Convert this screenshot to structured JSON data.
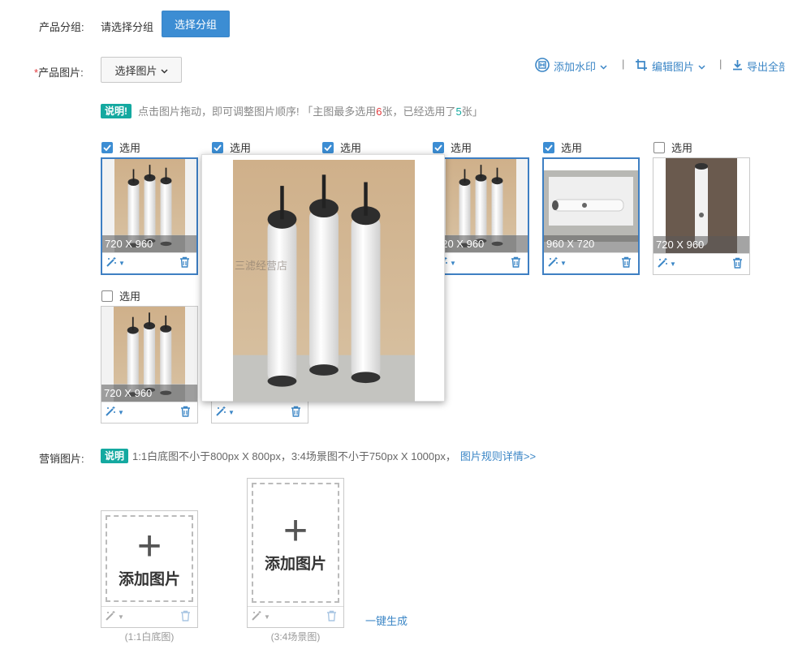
{
  "group": {
    "label": "产品分组:",
    "placeholder": "请选择分组",
    "button": "选择分组"
  },
  "images": {
    "label": "产品图片:",
    "required_mark": "*",
    "select_button": "选择图片",
    "toolbar": {
      "watermark": "添加水印",
      "edit": "编辑图片",
      "export": "导出全部"
    },
    "notice": {
      "tag": "说明!",
      "text_before": "点击图片拖动，即可调整图片顺序!  「主图最多选用",
      "max": "6",
      "text_mid": "张，已经选用了",
      "used": "5",
      "text_after": "张」"
    },
    "checkbox_label": "选用",
    "items": [
      {
        "checked": true,
        "dims": "720 X 960",
        "selected": true
      },
      {
        "checked": true,
        "dims": "",
        "selected": true
      },
      {
        "checked": true,
        "dims": "",
        "selected": true
      },
      {
        "checked": true,
        "dims": "720 X 960",
        "selected": true
      },
      {
        "checked": true,
        "dims": "960 X 720",
        "selected": true
      },
      {
        "checked": false,
        "dims": "720 X 960",
        "selected": false
      },
      {
        "checked": false,
        "dims": "720 X 960",
        "selected": false
      }
    ],
    "preview_watermark": "三滤经营店"
  },
  "marketing": {
    "label": "营销图片:",
    "tag": "说明",
    "text": "1:1白底图不小于800px X 800px，3:4场景图不小于750px X 1000px，",
    "link": "图片规则详情>>",
    "add_label": "添加图片",
    "caption_square": "(1:1白底图)",
    "caption_tall": "(3:4场景图)",
    "generate": "一键生成"
  },
  "colors": {
    "accent": "#3c8dd3",
    "tag": "#14a9a0",
    "required": "#e4393c",
    "count_max": "#e4393c",
    "count_used": "#14a9a0"
  },
  "icons": [
    "magic-wand-icon",
    "trash-icon",
    "watermark-icon",
    "crop-icon",
    "download-icon",
    "chevron-down-icon",
    "plus-icon",
    "check-icon"
  ]
}
